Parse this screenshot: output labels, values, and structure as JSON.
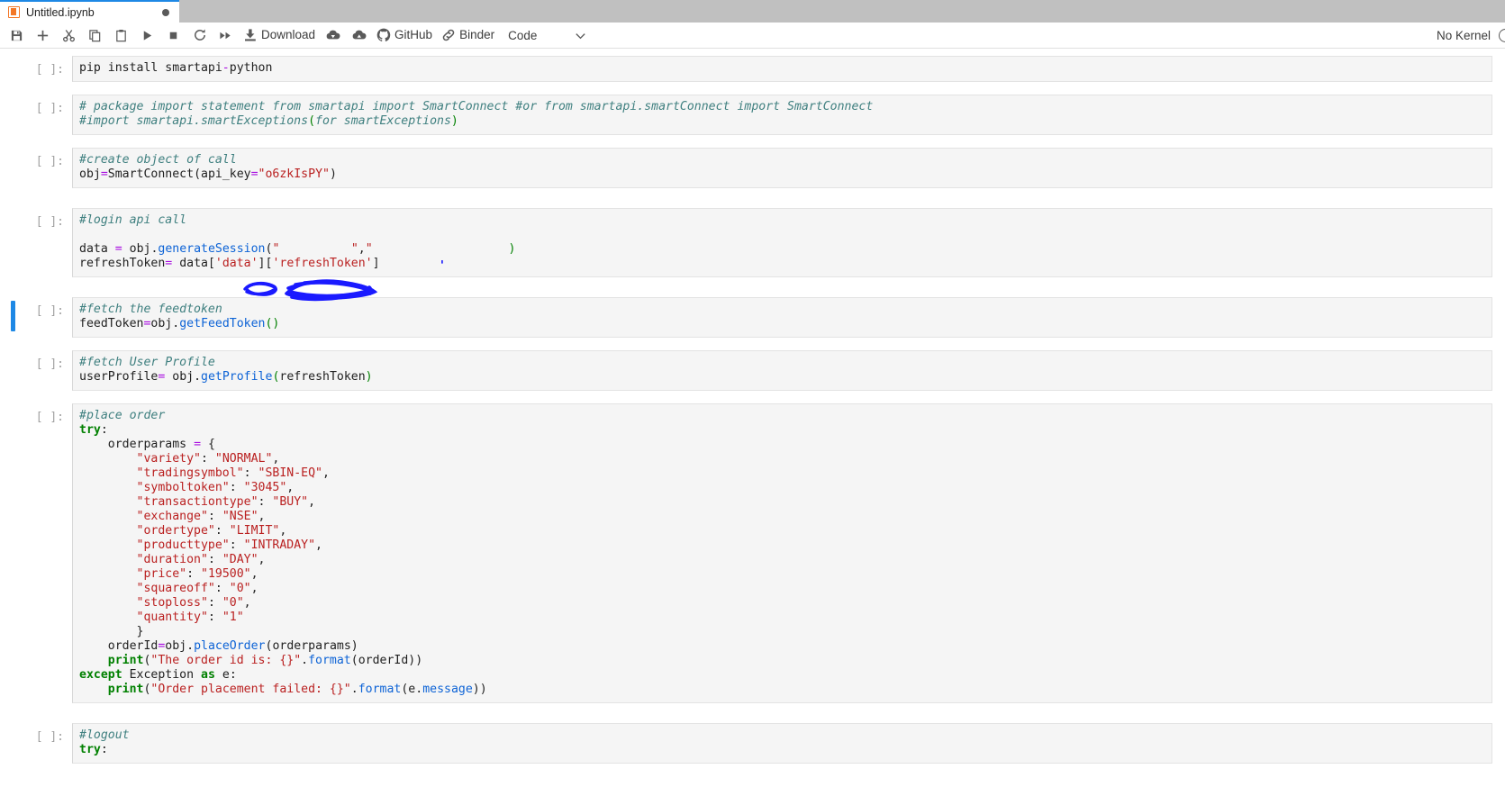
{
  "window": {
    "tab": {
      "title": "Untitled.ipynb",
      "icon": "notebook-icon",
      "unsaved_indicator": "●"
    }
  },
  "toolbar": {
    "buttons": [
      {
        "name": "save-button",
        "icon": "save-icon",
        "tooltip": "Save"
      },
      {
        "name": "insert-cell-button",
        "icon": "plus-icon",
        "tooltip": "Insert"
      },
      {
        "name": "cut-button",
        "icon": "scissors-icon",
        "tooltip": "Cut"
      },
      {
        "name": "copy-button",
        "icon": "copy-icon",
        "tooltip": "Copy"
      },
      {
        "name": "paste-button",
        "icon": "clipboard-icon",
        "tooltip": "Paste"
      },
      {
        "name": "run-button",
        "icon": "play-icon",
        "tooltip": "Run"
      },
      {
        "name": "stop-button",
        "icon": "stop-square-icon",
        "tooltip": "Interrupt"
      },
      {
        "name": "restart-button",
        "icon": "restart-arrow-icon",
        "tooltip": "Restart"
      },
      {
        "name": "run-all-button",
        "icon": "fast-forward-icon",
        "tooltip": "Restart and run all"
      }
    ],
    "download_label": "Download",
    "download_icon": "download-icon",
    "cloud_download_icon": "cloud-download-icon",
    "cloud_upload_icon": "cloud-upload-icon",
    "github_label": "GitHub",
    "github_icon": "github-icon",
    "binder_label": "Binder",
    "binder_icon": "link-icon",
    "celltype_label": "Code",
    "celltype_caret_icon": "chevron-down-icon",
    "kernel_label": "No Kernel",
    "kernel_icon": "kernel-status-circle-icon"
  },
  "colors": {
    "accent_blue": "#1e88e5",
    "jupyter_orange": "#f37726",
    "cell_background": "#f5f5f5",
    "tabbar_background": "#c0c0c0",
    "redaction_ink": "#1a1aff"
  },
  "notebook": {
    "prompt_empty": "[ ]:",
    "selected_cell_index": 4,
    "cells": [
      {
        "name": "cell-pip-install",
        "prompt": "[ ]:",
        "selected": false,
        "source": "pip install smartapi-python"
      },
      {
        "name": "cell-package-import",
        "prompt": "[ ]:",
        "selected": false,
        "source": "# package import statement from smartapi import SmartConnect #or from smartapi.smartConnect import SmartConnect\n#import smartapi.smartExceptions(for smartExceptions)"
      },
      {
        "name": "cell-create-object",
        "prompt": "[ ]:",
        "selected": false,
        "source": "#create object of call\nobj=SmartConnect(api_key=\"o6zkIsPY\")"
      },
      {
        "name": "cell-login-api-call",
        "prompt": "[ ]:",
        "selected": false,
        "redacted": true,
        "source": "#login api call\n\ndata = obj.generateSession(\"█████\",\"████████████\")\nrefreshToken= data['data']['refreshToken']"
      },
      {
        "name": "cell-fetch-feedtoken",
        "prompt": "[ ]:",
        "selected": true,
        "source": "#fetch the feedtoken\nfeedToken=obj.getFeedToken()"
      },
      {
        "name": "cell-fetch-user-profile",
        "prompt": "[ ]:",
        "selected": false,
        "source": "#fetch User Profile\nuserProfile= obj.getProfile(refreshToken)"
      },
      {
        "name": "cell-place-order",
        "prompt": "[ ]:",
        "selected": false,
        "source": "#place order\ntry:\n    orderparams = {\n        \"variety\": \"NORMAL\",\n        \"tradingsymbol\": \"SBIN-EQ\",\n        \"symboltoken\": \"3045\",\n        \"transactiontype\": \"BUY\",\n        \"exchange\": \"NSE\",\n        \"ordertype\": \"LIMIT\",\n        \"producttype\": \"INTRADAY\",\n        \"duration\": \"DAY\",\n        \"price\": \"19500\",\n        \"squareoff\": \"0\",\n        \"stoploss\": \"0\",\n        \"quantity\": \"1\"\n        }\n    orderId=obj.placeOrder(orderparams)\n    print(\"The order id is: {}\".format(orderId))\nexcept Exception as e:\n    print(\"Order placement failed: {}\".format(e.message))",
        "order_params": {
          "variety": "NORMAL",
          "tradingsymbol": "SBIN-EQ",
          "symboltoken": "3045",
          "transactiontype": "BUY",
          "exchange": "NSE",
          "ordertype": "LIMIT",
          "producttype": "INTRADAY",
          "duration": "DAY",
          "price": "19500",
          "squareoff": "0",
          "stoploss": "0",
          "quantity": "1"
        }
      },
      {
        "name": "cell-logout",
        "prompt": "[ ]:",
        "selected": false,
        "source": "#logout\ntry:"
      }
    ]
  }
}
